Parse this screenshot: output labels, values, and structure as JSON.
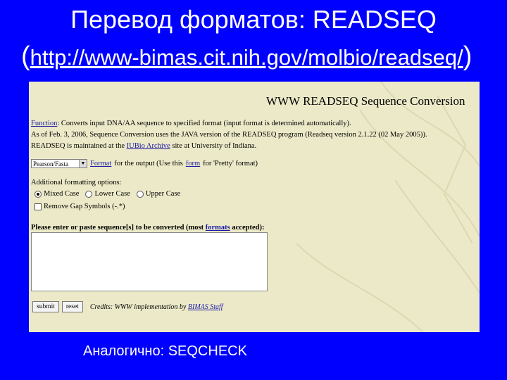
{
  "slide": {
    "title": "Перевод форматов: READSEQ",
    "url_open": "(",
    "url": "http://www-bimas.cit.nih.gov/molbio/readseq/",
    "url_close": ")",
    "footer": "Аналогично: SEQCHECK"
  },
  "page": {
    "title": "WWW READSEQ Sequence Conversion",
    "function_label": "Function",
    "function_text": ": Converts input DNA/AA sequence to specified format (input format is determined automatically).",
    "line2": "As of Feb. 3, 2006, Sequence Conversion uses the JAVA version of the READSEQ program (Readseq version 2.1.22 (02 May 2005)).",
    "line3_a": "READSEQ is maintained at the ",
    "line3_link": "IUBio Archive",
    "line3_b": " site at University of Indiana.",
    "format_select_value": "Pearson/Fasta",
    "format_link": "Format",
    "format_text_a": " for the output (Use this ",
    "format_form_link": "form",
    "format_text_b": " for 'Pretty' format)",
    "additional_label": "Additional formatting options:",
    "case_options": [
      "Mixed Case",
      "Lower Case",
      "Upper Case"
    ],
    "remove_gap_label": "Remove Gap Symbols (-.*)",
    "sequence_prompt_a": "Please enter or paste sequence[s] to be converted (most ",
    "sequence_prompt_link": "formats",
    "sequence_prompt_b": " accepted):",
    "submit_label": "submit",
    "reset_label": "reset",
    "credits_a": "Credits: WWW implementation by ",
    "credits_link": "BIMAS Staff"
  }
}
